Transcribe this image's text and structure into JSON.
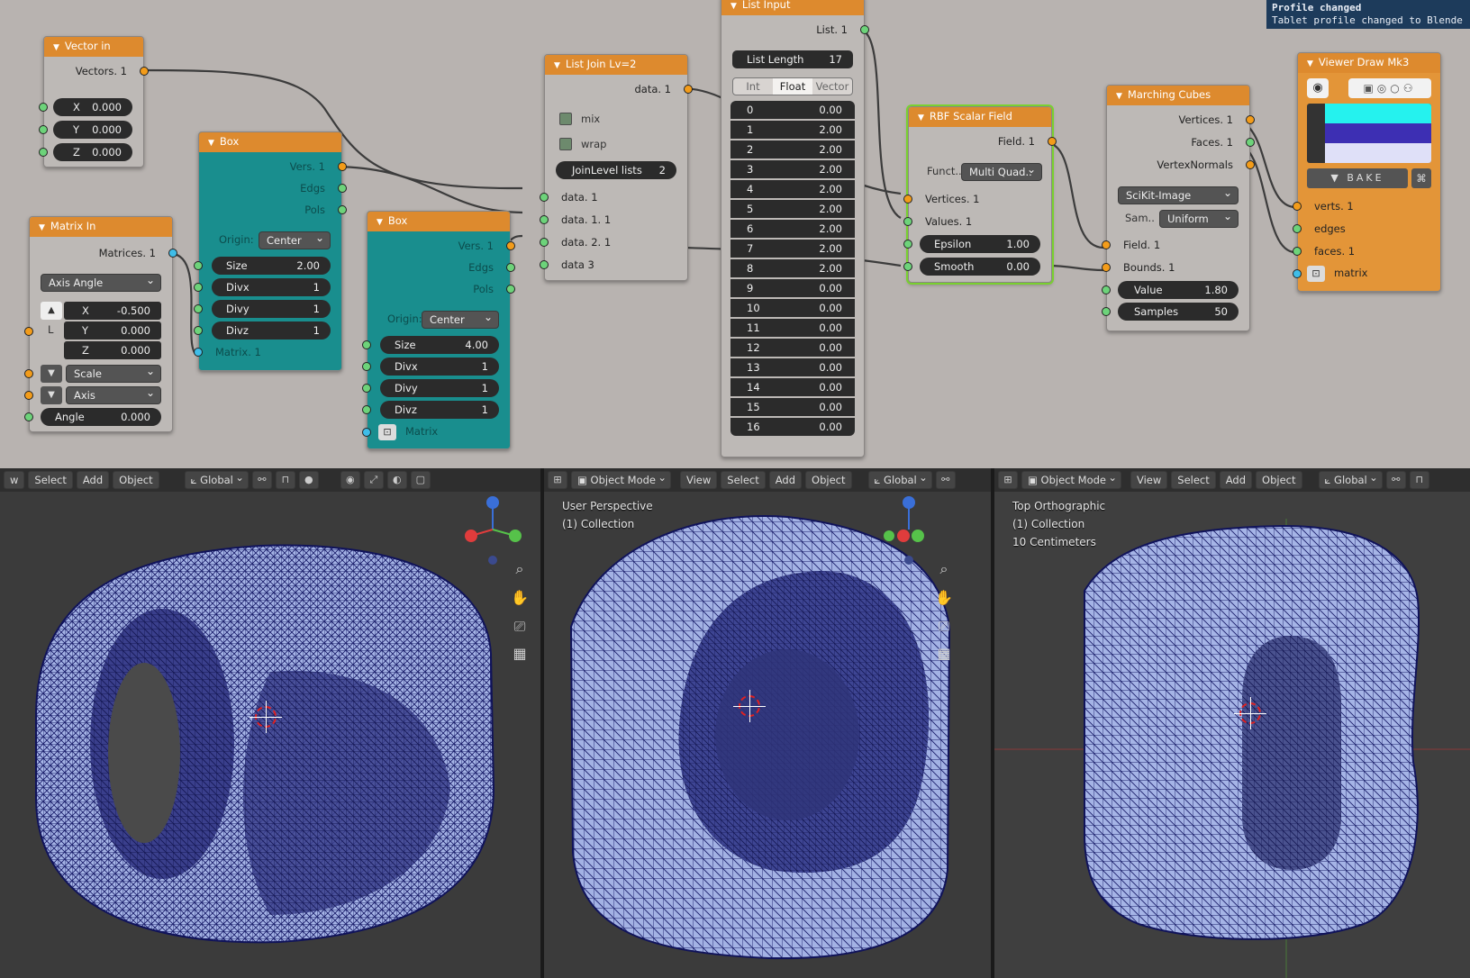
{
  "toast": {
    "title": "Profile changed",
    "message": "Tablet profile changed to Blende"
  },
  "nodes": {
    "vector_in": {
      "title": "Vector in",
      "output": "Vectors. 1",
      "x": "X",
      "x_val": "0.000",
      "y": "Y",
      "y_val": "0.000",
      "z": "Z",
      "z_val": "0.000"
    },
    "matrix_in": {
      "title": "Matrix In",
      "output": "Matrices. 1",
      "mode": "Axis Angle",
      "l_label": "L",
      "x": "X",
      "x_val": "-0.500",
      "y": "Y",
      "y_val": "0.000",
      "z": "Z",
      "z_val": "0.000",
      "scale": "Scale",
      "axis": "Axis",
      "angle": "Angle",
      "angle_val": "0.000"
    },
    "box1": {
      "title": "Box",
      "out_vers": "Vers. 1",
      "out_edgs": "Edgs",
      "out_pols": "Pols",
      "origin_label": "Origin:",
      "origin": "Center",
      "size": "Size",
      "size_val": "2.00",
      "divx": "Divx",
      "divx_val": "1",
      "divy": "Divy",
      "divy_val": "1",
      "divz": "Divz",
      "divz_val": "1",
      "matrix": "Matrix. 1"
    },
    "box2": {
      "title": "Box",
      "out_vers": "Vers. 1",
      "out_edgs": "Edgs",
      "out_pols": "Pols",
      "origin_label": "Origin:",
      "origin": "Center",
      "size": "Size",
      "size_val": "4.00",
      "divx": "Divx",
      "divx_val": "1",
      "divy": "Divy",
      "divy_val": "1",
      "divz": "Divz",
      "divz_val": "1",
      "matrix": "Matrix"
    },
    "list_join": {
      "title": "List Join Lv=2",
      "output": "data. 1",
      "mix": "mix",
      "wrap": "wrap",
      "join_label": "JoinLevel lists",
      "join_val": "2",
      "in1": "data. 1",
      "in2": "data. 1. 1",
      "in3": "data. 2. 1",
      "in4": "data 3"
    },
    "list_input": {
      "title": "List Input",
      "output": "List. 1",
      "length_label": "List Length",
      "length_val": "17",
      "modes": [
        "Int",
        "Float",
        "Vector"
      ],
      "active_mode": "Float",
      "rows": [
        [
          "0",
          "0.00"
        ],
        [
          "1",
          "2.00"
        ],
        [
          "2",
          "2.00"
        ],
        [
          "3",
          "2.00"
        ],
        [
          "4",
          "2.00"
        ],
        [
          "5",
          "2.00"
        ],
        [
          "6",
          "2.00"
        ],
        [
          "7",
          "2.00"
        ],
        [
          "8",
          "2.00"
        ],
        [
          "9",
          "0.00"
        ],
        [
          "10",
          "0.00"
        ],
        [
          "11",
          "0.00"
        ],
        [
          "12",
          "0.00"
        ],
        [
          "13",
          "0.00"
        ],
        [
          "14",
          "0.00"
        ],
        [
          "15",
          "0.00"
        ],
        [
          "16",
          "0.00"
        ]
      ]
    },
    "rbf": {
      "title": "RBF Scalar Field",
      "output": "Field. 1",
      "funct_label": "Funct..",
      "funct": "Multi Quad..",
      "in_vertices": "Vertices. 1",
      "in_values": "Values. 1",
      "epsilon": "Epsilon",
      "epsilon_val": "1.00",
      "smooth": "Smooth",
      "smooth_val": "0.00"
    },
    "marching": {
      "title": "Marching Cubes",
      "out_vertices": "Vertices. 1",
      "out_faces": "Faces. 1",
      "out_normals": "VertexNormals",
      "implementation": "SciKit-Image",
      "sam_label": "Sam..",
      "sam": "Uniform",
      "in_field": "Field. 1",
      "in_bounds": "Bounds. 1",
      "value": "Value",
      "value_val": "1.80",
      "samples": "Samples",
      "samples_val": "50"
    },
    "viewer": {
      "title": "Viewer Draw Mk3",
      "bake": "BAKE",
      "in_verts": "verts. 1",
      "in_edges": "edges",
      "in_faces": "faces. 1",
      "in_matrix": "matrix",
      "colors": [
        "#25f2ee",
        "#3d2fb3",
        "#dfe0f8"
      ]
    }
  },
  "viewports": [
    {
      "header": [
        "Select",
        "Add",
        "Object"
      ],
      "first": "w",
      "orientation": "Global",
      "overlay": []
    },
    {
      "header": [
        "View",
        "Select",
        "Add",
        "Object"
      ],
      "mode": "Object Mode",
      "orientation": "Global",
      "overlay": [
        "User Perspective",
        "(1) Collection"
      ]
    },
    {
      "header": [
        "View",
        "Select",
        "Add",
        "Object"
      ],
      "mode": "Object Mode",
      "orientation": "Global",
      "overlay": [
        "Top Orthographic",
        "(1) Collection",
        "10 Centimeters"
      ]
    }
  ],
  "colors": {
    "node_header": "#dd8a2e",
    "teal": "#198e8e",
    "mesh": "#1b1f6b",
    "mesh_face": "#a9b7e8"
  },
  "icons": [
    "search-icon",
    "hand-icon",
    "camera-icon",
    "grid-icon",
    "eye-icon",
    "bake-icon"
  ]
}
